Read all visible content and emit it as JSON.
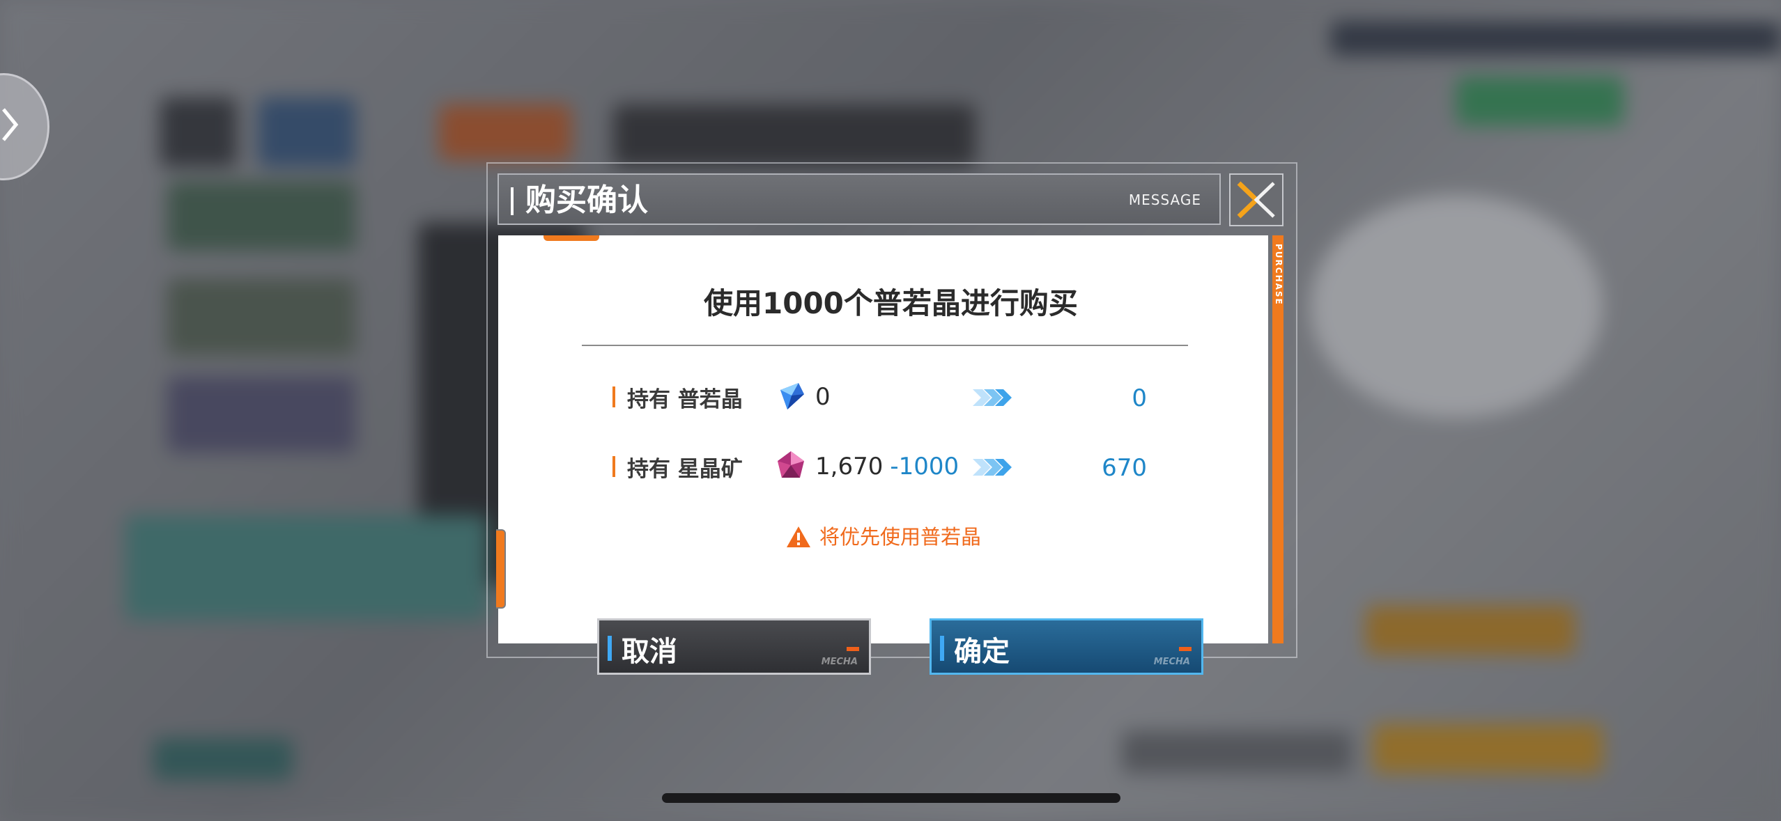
{
  "dialog": {
    "title": "购买确认",
    "header_tag": "MESSAGE",
    "side_label": "PURCHASE",
    "message": "使用1000个普若晶进行购买",
    "rows": [
      {
        "label": "持有 普若晶",
        "icon": "blue-crystal-icon",
        "current": "0",
        "delta": "",
        "result": "0"
      },
      {
        "label": "持有 星晶矿",
        "icon": "pink-crystal-icon",
        "current": "1,670",
        "delta": "-1000",
        "result": "670"
      }
    ],
    "warning": "将优先使用普若晶",
    "cancel_label": "取消",
    "confirm_label": "确定",
    "button_tag": "MECHA"
  },
  "colors": {
    "accent_orange": "#f07a1e",
    "value_blue": "#1e86c8",
    "warning_orange": "#f06a1c",
    "confirm_border": "#52b7ef"
  }
}
